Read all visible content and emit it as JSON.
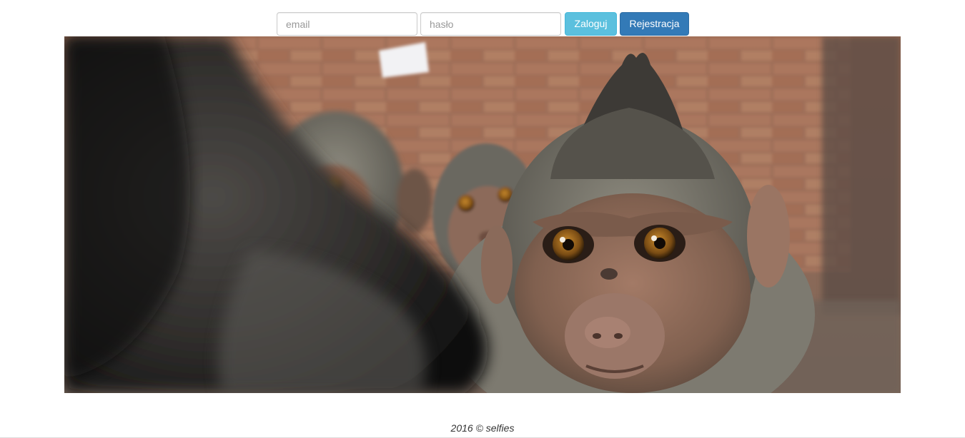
{
  "login": {
    "email_placeholder": "email",
    "password_placeholder": "hasło",
    "login_label": "Zaloguj",
    "register_label": "Rejestracja"
  },
  "hero": {
    "subject": "monkey-selfie-photo"
  },
  "footer": {
    "text": "2016 © selfies"
  },
  "colors": {
    "login_button": "#5bc0de",
    "register_button": "#337ab7",
    "footer_text": "#333333"
  }
}
